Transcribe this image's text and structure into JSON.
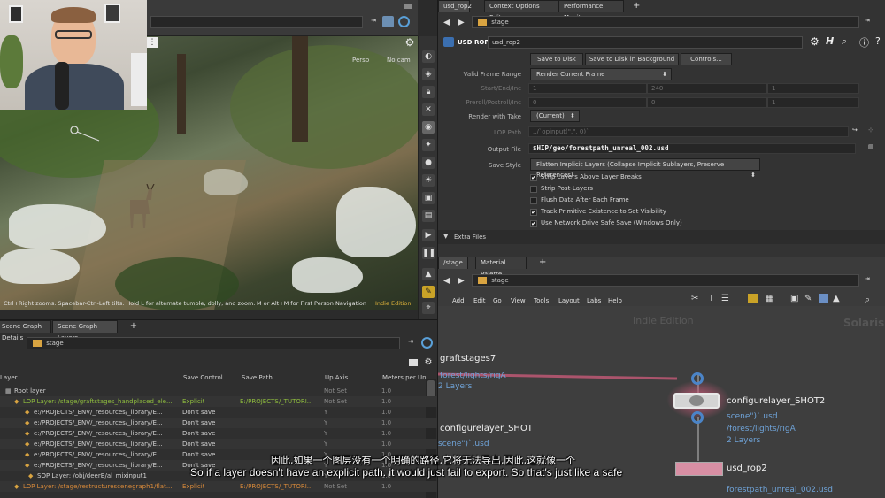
{
  "viewport": {
    "hint": "Ctrl+Right zooms. Spacebar-Ctrl-Left tilts. Hold L for alternate tumble, dolly, and zoom.",
    "hint2": "M or Alt+M for First Person Navigation",
    "persp": "Persp",
    "camera": "No cam",
    "edition": "Indie Edition"
  },
  "scene_graph": {
    "tabs": [
      "Scene Graph Details",
      "Scene Graph Layers"
    ],
    "path_label": "stage",
    "columns": [
      "Layer",
      "Save Control",
      "Save Path",
      "Up Axis",
      "Meters per Un"
    ],
    "rows": [
      {
        "name": "Root layer",
        "save": "",
        "path": "",
        "up": "Not Set",
        "m": "1.0",
        "cls": ""
      },
      {
        "name": "LOP Layer: /stage/graftstages_handplaced_ele...",
        "save": "Explicit",
        "path": "E:/PROJECTS/_TUTORI...",
        "up": "Not Set",
        "m": "1.0",
        "cls": "green"
      },
      {
        "name": "e:/PROJECTS/_ENV/_resources/_library/E...",
        "save": "Don't save",
        "path": "",
        "up": "Y",
        "m": "1.0",
        "cls": ""
      },
      {
        "name": "e:/PROJECTS/_ENV/_resources/_library/E...",
        "save": "Don't save",
        "path": "",
        "up": "Y",
        "m": "1.0",
        "cls": ""
      },
      {
        "name": "e:/PROJECTS/_ENV/_resources/_library/E...",
        "save": "Don't save",
        "path": "",
        "up": "Y",
        "m": "1.0",
        "cls": ""
      },
      {
        "name": "e:/PROJECTS/_ENV/_resources/_library/E...",
        "save": "Don't save",
        "path": "",
        "up": "Y",
        "m": "1.0",
        "cls": ""
      },
      {
        "name": "e:/PROJECTS/_ENV/_resources/_library/E...",
        "save": "Don't save",
        "path": "",
        "up": "Y",
        "m": "1.0",
        "cls": ""
      },
      {
        "name": "e:/PROJECTS/_ENV/_resources/_library/E...",
        "save": "Don't save",
        "path": "",
        "up": "Y",
        "m": "1.0",
        "cls": ""
      },
      {
        "name": "SOP Layer: /obj/deerB/al_mixinput1",
        "save": "",
        "path": "",
        "up": "Y",
        "m": "1.0",
        "cls": ""
      },
      {
        "name": "LOP Layer: /stage/restructurescenegraph1/flat...",
        "save": "Explicit",
        "path": "E:/PROJECTS/_TUTORI...",
        "up": "Not Set",
        "m": "1.0",
        "cls": "orange"
      }
    ]
  },
  "top_right": {
    "tabs": [
      "usd_rop2",
      "Context Options Editor",
      "Performance Monitor"
    ],
    "path_label": "stage",
    "node_type": "USD ROP",
    "node_name": "usd_rop2",
    "buttons": {
      "save": "Save to Disk",
      "save_bg": "Save to Disk in Background",
      "controls": "Controls..."
    },
    "params": {
      "valid_frame_range_label": "Valid Frame Range",
      "valid_frame_range": "Render Current Frame",
      "start_end_label": "Start/End/Inc",
      "start": "1",
      "end": "240",
      "inc": "1",
      "preroll_label": "Preroll/Postroll/Inc",
      "pre": "0",
      "post": "0",
      "pinc": "1",
      "render_take_label": "Render with Take",
      "render_take": "(Current)",
      "lop_path_label": "LOP Path",
      "lop_path": "../`opinput(\".\", 0)`",
      "output_file_label": "Output File",
      "output_file": "$HIP/geo/forestpath_unreal_002.usd",
      "save_style_label": "Save Style",
      "save_style": "Flatten Implicit Layers (Collapse Implicit Sublayers, Preserve References)"
    },
    "checks": [
      {
        "label": "Strip Layers Above Layer Breaks",
        "on": "✔"
      },
      {
        "label": "Strip Post-Layers",
        "on": ""
      },
      {
        "label": "Flush Data After Each Frame",
        "on": ""
      },
      {
        "label": "Track Primitive Existence to Set Visibility",
        "on": "✔"
      },
      {
        "label": "Use Network Drive Safe Save (Windows Only)",
        "on": "✔"
      }
    ],
    "extra_files": "Extra Files"
  },
  "network": {
    "tabs": [
      "/stage",
      "Material Palette"
    ],
    "path_label": "stage",
    "menu": [
      "Add",
      "Edit",
      "Go",
      "View",
      "Tools",
      "Layout",
      "Labs",
      "Help"
    ],
    "edition": "Indie Edition",
    "brand": "Solaris",
    "nodes": {
      "graftstages_name": "graftstages7",
      "graftstages_sub1": "forest/lights/rigA",
      "graftstages_sub2": "2 Layers",
      "configure_shot_name": "configurelayer_SHOT",
      "configure_shot_sub": "scene\")`.usd",
      "configure2_name": "configurelayer_SHOT2",
      "configure2_sub1": "scene\")`.usd",
      "configure2_sub2": "/forest/lights/rigA",
      "configure2_sub3": "2 Layers",
      "rop_name": "usd_rop2",
      "rop_sub": "forestpath_unreal_002.usd"
    }
  },
  "subtitles": {
    "zh": "因此,如果一个图层没有一个明确的路径,它将无法导出,因此,这就像一个",
    "en": "So if a layer doesn't have an explicit path. it would just fail to export. So that's just like a safe"
  },
  "colors": {
    "green": "#8fbd3e",
    "orange": "#d7893a",
    "blue": "#6fa3d8"
  }
}
